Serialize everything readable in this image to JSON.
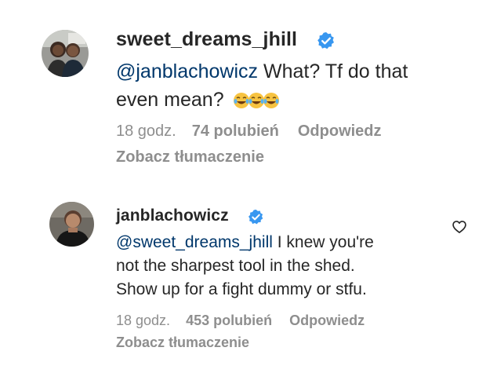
{
  "comments": [
    {
      "username": "sweet_dreams_jhill",
      "mention": "@janblachowicz",
      "text_line1": " What? Tf do that",
      "text_line2": "even mean?",
      "emoji": [
        "😂",
        "😂",
        "😂"
      ],
      "time": "18 godz.",
      "likes": "74 polubień",
      "reply": "Odpowiedz",
      "translate": "Zobacz tłumaczenie"
    },
    {
      "username": "janblachowicz",
      "mention": "@sweet_dreams_jhill",
      "text_line1": " I knew you're",
      "text_line2": "not the sharpest tool in the shed.",
      "text_line3": "Show up for a fight dummy or stfu.",
      "time": "18 godz.",
      "likes": "453 polubień",
      "reply": "Odpowiedz",
      "translate": "Zobacz tłumaczenie"
    }
  ],
  "icons": {
    "verified": "verified-badge-icon",
    "like": "heart-outline-icon"
  },
  "colors": {
    "text": "#262626",
    "secondary": "#8e8e8e",
    "mention": "#00376b",
    "verified": "#3897f0"
  }
}
